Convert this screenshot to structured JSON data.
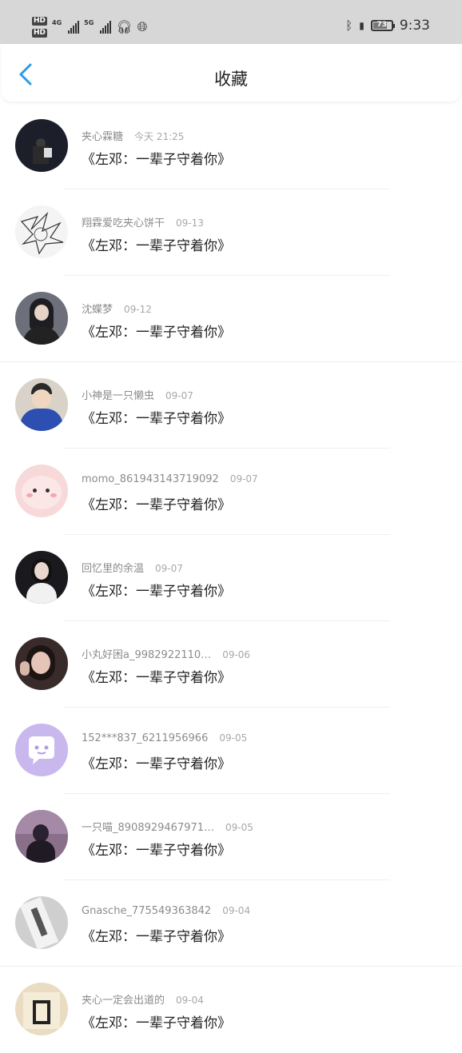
{
  "status_bar": {
    "hd1": "HD",
    "hd2": "HD",
    "net1": "4G",
    "net2": "5G",
    "battery_level": "73",
    "time": "9:33"
  },
  "header": {
    "title": "收藏",
    "back_icon": "chevron-left-icon"
  },
  "accent_color": "#2a9be8",
  "items": [
    {
      "user": "夹心霖糖",
      "date": "今天 21:25",
      "content": "《左邓：一辈子守着你》"
    },
    {
      "user": "翔霖爱吃夹心饼干",
      "date": "09-13",
      "content": "《左邓：一辈子守着你》"
    },
    {
      "user": "沈蝶梦",
      "date": "09-12",
      "content": "《左邓：一辈子守着你》"
    },
    {
      "user": "小神是一只懒虫",
      "date": "09-07",
      "content": "《左邓：一辈子守着你》"
    },
    {
      "user": "momo_86194314371909​2",
      "date": "09-07",
      "content": "《左邓：一辈子守着你》"
    },
    {
      "user": "回忆里的余温",
      "date": "09-07",
      "content": "《左邓：一辈子守着你》"
    },
    {
      "user": "小丸好困a_9982922110…",
      "date": "09-06",
      "content": "《左邓：一辈子守着你》"
    },
    {
      "user": "152***837_6211956966",
      "date": "09-05",
      "content": "《左邓：一辈子守着你》"
    },
    {
      "user": "一只喵_8908929467971…",
      "date": "09-05",
      "content": "《左邓：一辈子守着你》"
    },
    {
      "user": "Gnasche_775549363842",
      "date": "09-04",
      "content": "《左邓：一辈子守着你》"
    },
    {
      "user": "夹心一定会出道的",
      "date": "09-04",
      "content": "《左邓：一辈子守着你》"
    }
  ]
}
